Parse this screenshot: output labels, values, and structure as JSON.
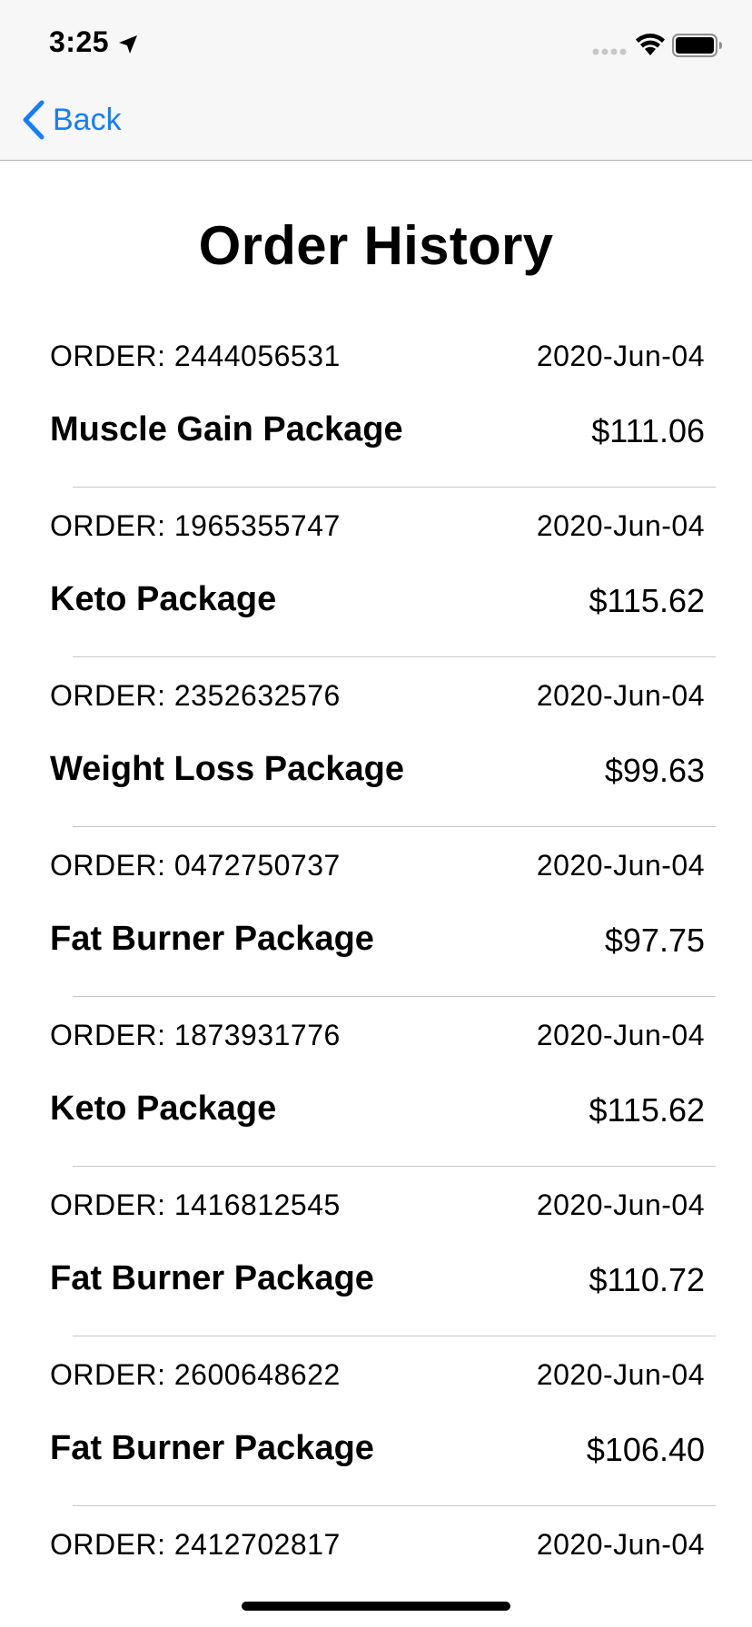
{
  "status_bar": {
    "time": "3:25"
  },
  "nav": {
    "back_label": "Back"
  },
  "page": {
    "title": "Order History"
  },
  "colors": {
    "accent": "#147efb",
    "separator": "#c8c7cc",
    "bar_background": "#f7f7f7"
  },
  "orders": [
    {
      "order": "ORDER: 2444056531",
      "date": "2020-Jun-04",
      "name": "Muscle Gain Package",
      "price": "$111.06"
    },
    {
      "order": "ORDER: 1965355747",
      "date": "2020-Jun-04",
      "name": "Keto Package",
      "price": "$115.62"
    },
    {
      "order": "ORDER: 2352632576",
      "date": "2020-Jun-04",
      "name": "Weight Loss Package",
      "price": "$99.63"
    },
    {
      "order": "ORDER: 0472750737",
      "date": "2020-Jun-04",
      "name": "Fat Burner Package",
      "price": "$97.75"
    },
    {
      "order": "ORDER: 1873931776",
      "date": "2020-Jun-04",
      "name": "Keto Package",
      "price": "$115.62"
    },
    {
      "order": "ORDER: 1416812545",
      "date": "2020-Jun-04",
      "name": "Fat Burner Package",
      "price": "$110.72"
    },
    {
      "order": "ORDER: 2600648622",
      "date": "2020-Jun-04",
      "name": "Fat Burner Package",
      "price": "$106.40"
    },
    {
      "order": "ORDER: 2412702817",
      "date": "2020-Jun-04",
      "name": "",
      "price": ""
    }
  ]
}
